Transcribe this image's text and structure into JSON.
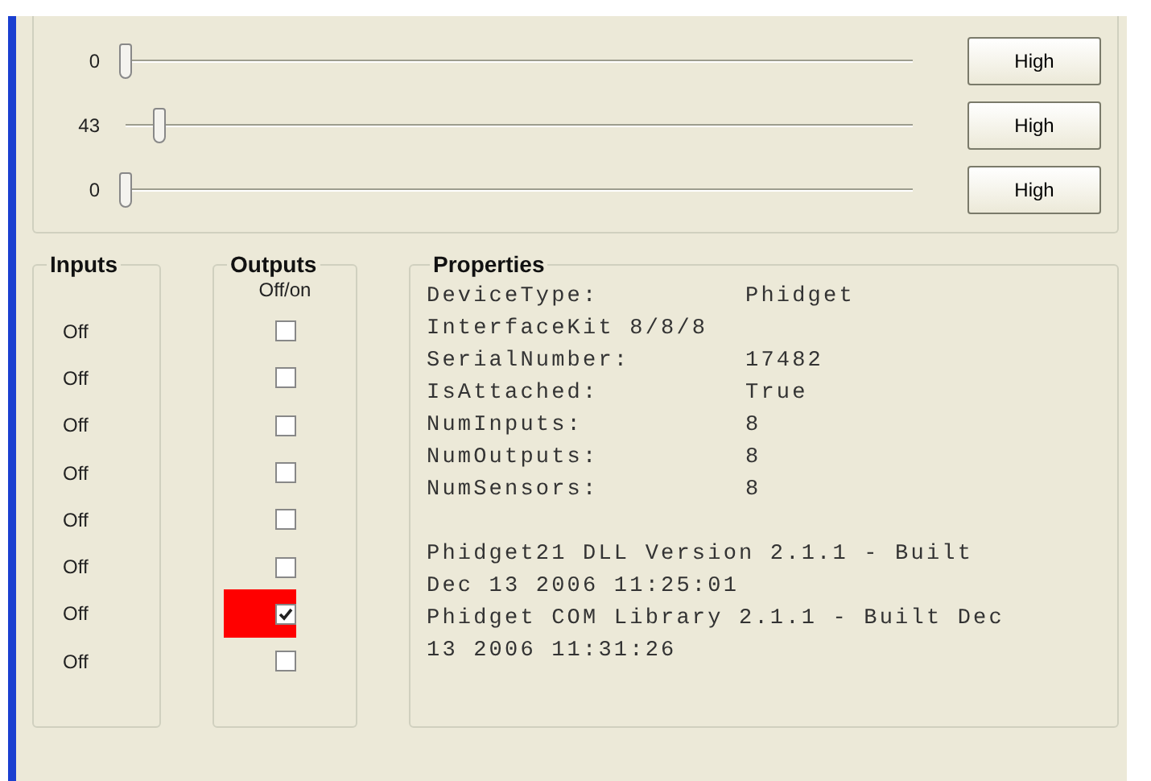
{
  "sensors": [
    {
      "value": "0",
      "level": 0,
      "button": "High"
    },
    {
      "value": "43",
      "level": 0.043,
      "button": "High"
    },
    {
      "value": "0",
      "level": 0,
      "button": "High"
    }
  ],
  "inputs": {
    "title": "Inputs",
    "items": [
      "Off",
      "Off",
      "Off",
      "Off",
      "Off",
      "Off",
      "Off",
      "Off"
    ]
  },
  "outputs": {
    "title": "Outputs",
    "header": "Off/on",
    "items": [
      {
        "checked": false
      },
      {
        "checked": false
      },
      {
        "checked": false
      },
      {
        "checked": false
      },
      {
        "checked": false
      },
      {
        "checked": false
      },
      {
        "checked": true
      },
      {
        "checked": false
      }
    ]
  },
  "properties": {
    "title": "Properties",
    "lines": [
      {
        "kind": "pair",
        "label": "DeviceType:",
        "value": "Phidget"
      },
      {
        "kind": "text",
        "text": "InterfaceKit 8/8/8"
      },
      {
        "kind": "pair",
        "label": "SerialNumber:",
        "value": "17482"
      },
      {
        "kind": "pair",
        "label": "IsAttached:",
        "value": "True"
      },
      {
        "kind": "pair",
        "label": "NumInputs:",
        "value": "8"
      },
      {
        "kind": "pair",
        "label": "NumOutputs:",
        "value": "8"
      },
      {
        "kind": "pair",
        "label": "NumSensors:",
        "value": "8"
      },
      {
        "kind": "gap"
      },
      {
        "kind": "text",
        "text": "Phidget21 DLL Version 2.1.1 - Built"
      },
      {
        "kind": "text",
        "text": "Dec 13 2006 11:25:01"
      },
      {
        "kind": "text",
        "text": "Phidget COM Library 2.1.1 - Built Dec"
      },
      {
        "kind": "text",
        "text": "13 2006 11:31:26"
      }
    ]
  }
}
